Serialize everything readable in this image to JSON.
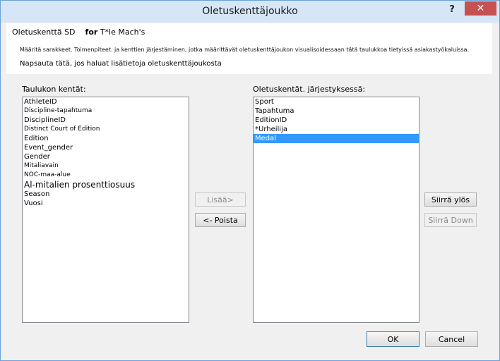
{
  "window": {
    "title": "Oletuskenttäjoukko",
    "help_glyph": "?",
    "close_glyph": "✕"
  },
  "header": {
    "line1_a": "Oletuskenttä SD",
    "line1_b": "for",
    "line1_c": " T*le Mach's",
    "line2": "Määritä sarakkeet. Toimenpiteet. ja kenttien järjestäminen, jotka määrittävät oletuskenttäjoukon visualisoidessaan tätä taulukkoa tietyissä asiakastyökaluissa.",
    "line3": "Napsauta tätä, jos haluat lisätietoja oletuskenttäjoukosta"
  },
  "left_list": {
    "label": "Taulukon kentät:",
    "items": [
      "AthleteID",
      "Discipline-tapahtuma",
      "DisciplineID",
      "Distinct Court of Edition",
      "Edition",
      "Event_gender",
      "Gender",
      "Mitaliavain",
      "NOC-maa-alue",
      "Al-mitalien prosenttiosuus",
      "Season",
      "Vuosi"
    ]
  },
  "right_list": {
    "label": "Oletuskentät. järjestyksessä:",
    "items": [
      "Sport",
      "Tapahtuma",
      "EditionID",
      "*Urheilija",
      "Medal"
    ],
    "selected": "Medal"
  },
  "buttons": {
    "add": "Lisää>",
    "remove": "<- Poista",
    "move_up": "Siirrä ylös",
    "move_down": "Siirrä Down",
    "ok": "OK",
    "cancel": "Cancel"
  },
  "colors": {
    "selection": "#3399ff",
    "titlebar": "#d7e6f6",
    "close": "#c75050"
  }
}
